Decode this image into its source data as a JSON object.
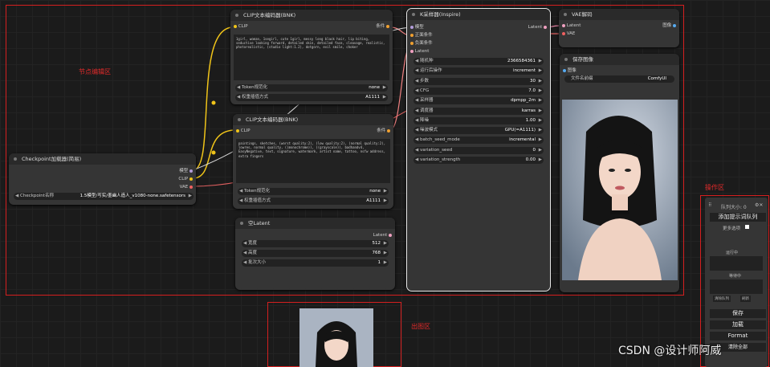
{
  "areas": {
    "node_edit": "节点编辑区",
    "operation": "操作区",
    "output": "出图区"
  },
  "clip_top": {
    "title": "CLIP文本编码器(BNK)",
    "in_clip": "CLIP",
    "out_cond": "条件",
    "text": "1girl, woman, 1segirl, cute 1girl, messy long black hair, lip biting, seductive looking forward, detailed skin, detailed face, cleavage, realistic, photorealistic, (studio light:1.2), dotgorn, evil smile, choker",
    "token_label": "Token规范化",
    "token_val": "none",
    "weight_label": "权重插值方式",
    "weight_val": "A1111"
  },
  "clip_bottom": {
    "title": "CLIP文本编码器(BNK)",
    "in_clip": "CLIP",
    "out_cond": "条件",
    "text": "paintings, sketches, (worst quality:2), (low quality:2), (normal quality:2), lowres, normal quality, ((monochrome)), ((grayscale)), badhandv4, EasyNegative, text, signature, watermark, artist name, tattoo, nsfw address, extra fingers",
    "token_label": "Token规范化",
    "token_val": "none",
    "weight_label": "权重插值方式",
    "weight_val": "A1111"
  },
  "checkpoint": {
    "title": "Checkpoint加载器(简易)",
    "out_model": "模型",
    "out_clip": "CLIP",
    "out_vae": "VAE",
    "ckpt_label": "Checkpoint名称",
    "ckpt_val": "1.5模型/写实/墨幽人造人_v1080-none.safetensors"
  },
  "latent": {
    "title": "空Latent",
    "out": "Latent",
    "w_label": "宽度",
    "w_val": "512",
    "h_label": "高度",
    "h_val": "768",
    "b_label": "批次大小",
    "b_val": "1"
  },
  "ksampler": {
    "title": "K采样器(Inspire)",
    "in_model": "模型",
    "in_pos": "正面条件",
    "in_neg": "负面条件",
    "in_latent": "Latent",
    "out": "Latent",
    "widgets": [
      [
        "随机种",
        "2366584361"
      ],
      [
        "运行后操作",
        "increment"
      ],
      [
        "步数",
        "30"
      ],
      [
        "CFG",
        "7.0"
      ],
      [
        "采样器",
        "dpmpp_2m"
      ],
      [
        "调度器",
        "karras"
      ],
      [
        "降噪",
        "1.00"
      ],
      [
        "噪波模式",
        "GPU(=A1111)"
      ],
      [
        "batch_seed_mode",
        "incremental"
      ],
      [
        "variation_seed",
        "0"
      ],
      [
        "variation_strength",
        "0.00"
      ]
    ]
  },
  "vae": {
    "title": "VAE解码",
    "in_latent": "Latent",
    "in_vae": "VAE",
    "out": "图像"
  },
  "save": {
    "title": "保存图像",
    "in_image": "图像",
    "prefix_label": "文件名前缀",
    "prefix_val": "ComfyUI"
  },
  "queue_panel": {
    "title": "队列大小: 0",
    "add": "添加提示词队列",
    "more": "更多选项",
    "running": "运行中",
    "pending": "等待中",
    "clear": "清除队列",
    "refresh": "刷新",
    "save": "保存",
    "load": "加载",
    "format": "Format",
    "clear2": "清除全部"
  },
  "watermark": "CSDN @设计师阿威"
}
